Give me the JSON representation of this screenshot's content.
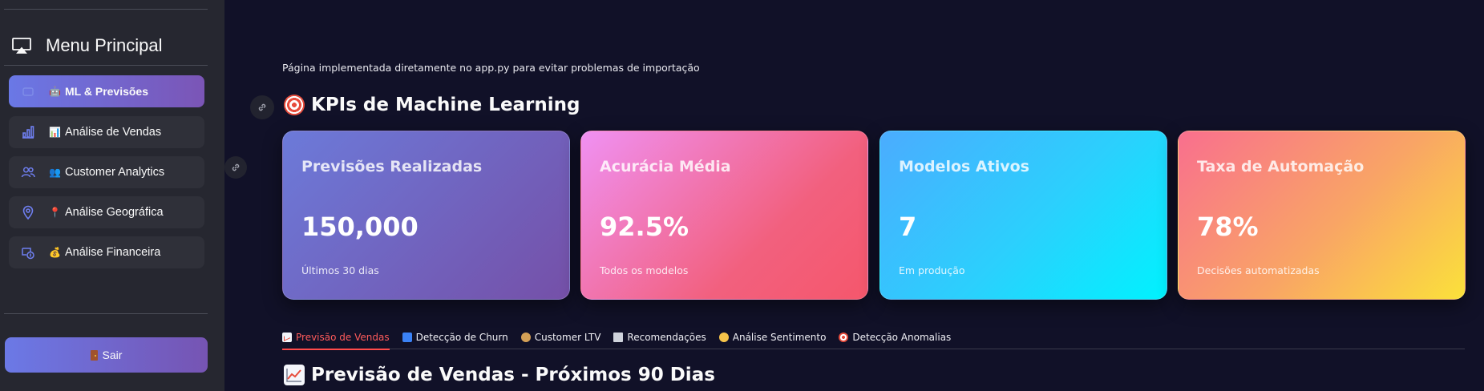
{
  "sidebar": {
    "menu_title": "Menu Principal",
    "items": [
      {
        "emoji": "🤖",
        "label": "ML & Previsões",
        "icon": "robot-icon",
        "active": true
      },
      {
        "emoji": "📊",
        "label": "Análise de Vendas",
        "icon": "bar-chart-icon",
        "active": false
      },
      {
        "emoji": "👥",
        "label": "Customer Analytics",
        "icon": "users-icon",
        "active": false
      },
      {
        "emoji": "📍",
        "label": "Análise Geográfica",
        "icon": "map-pin-icon",
        "active": false
      },
      {
        "emoji": "💰",
        "label": "Análise Financeira",
        "icon": "finance-icon",
        "active": false
      }
    ],
    "logout_label": "Sair"
  },
  "main": {
    "info_text": "Página implementada diretamente no app.py para evitar problemas de importação",
    "kpi_section_title": "KPIs de Machine Learning",
    "kpis": [
      {
        "title": "Previsões Realizadas",
        "value": "150,000",
        "subtitle": "Últimos 30 dias"
      },
      {
        "title": "Acurácia Média",
        "value": "92.5%",
        "subtitle": "Todos os modelos"
      },
      {
        "title": "Modelos Ativos",
        "value": "7",
        "subtitle": "Em produção"
      },
      {
        "title": "Taxa de Automação",
        "value": "78%",
        "subtitle": "Decisões automatizadas"
      }
    ],
    "tabs": [
      {
        "label": "Previsão de Vendas",
        "icon": "chart-up-icon",
        "active": true
      },
      {
        "label": "Detecção de Churn",
        "icon": "repeat-icon",
        "active": false
      },
      {
        "label": "Customer LTV",
        "icon": "money-bag-icon",
        "active": false
      },
      {
        "label": "Recomendações",
        "icon": "shopping-cart-icon",
        "active": false
      },
      {
        "label": "Análise Sentimento",
        "icon": "smile-icon",
        "active": false
      },
      {
        "label": "Detecção Anomalias",
        "icon": "target-icon",
        "active": false
      }
    ],
    "forecast_title": "Previsão de Vendas - Próximos 90 Dias"
  },
  "colors": {
    "sidebar_bg": "#262730",
    "main_bg": "#111128",
    "active_tab": "#ff4b4b",
    "accent_gradient_start": "#6a78e6",
    "accent_gradient_end": "#7b55b6"
  }
}
